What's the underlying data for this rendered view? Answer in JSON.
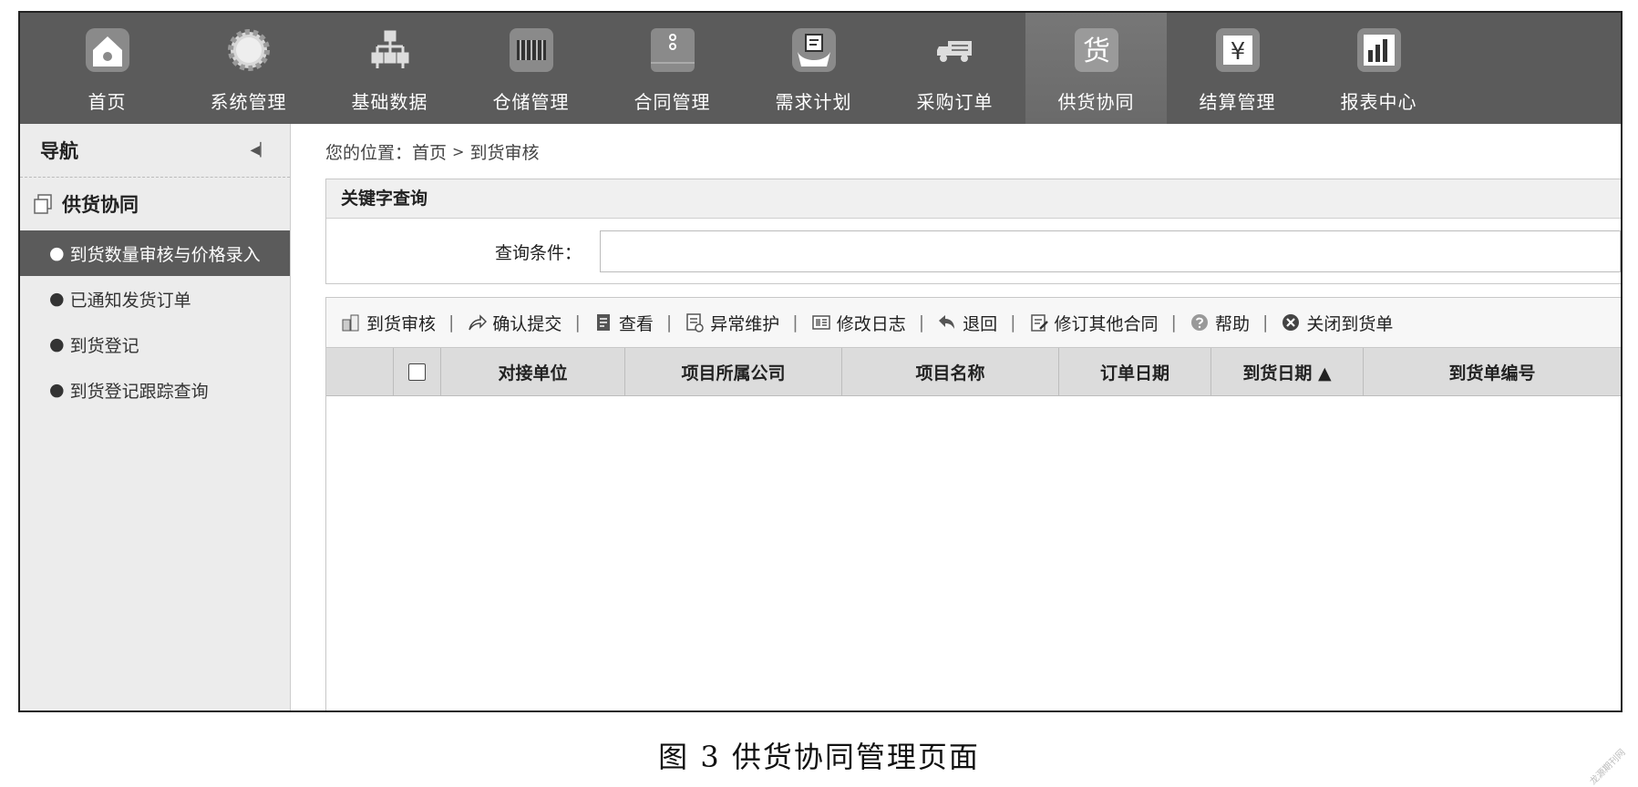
{
  "top_nav": {
    "items": [
      {
        "label": "首页",
        "icon": "home-icon"
      },
      {
        "label": "系统管理",
        "icon": "gear-icon"
      },
      {
        "label": "基础数据",
        "icon": "hierarchy-icon"
      },
      {
        "label": "仓储管理",
        "icon": "warehouse-icon"
      },
      {
        "label": "合同管理",
        "icon": "folder-icon"
      },
      {
        "label": "需求计划",
        "icon": "hand-document-icon"
      },
      {
        "label": "采购订单",
        "icon": "truck-icon"
      },
      {
        "label": "供货协同",
        "icon": "goods-icon",
        "icon_text": "货"
      },
      {
        "label": "结算管理",
        "icon": "yen-icon",
        "icon_text": "¥"
      },
      {
        "label": "报表中心",
        "icon": "bar-chart-icon"
      }
    ],
    "active_index": 7
  },
  "sidebar": {
    "title": "导航",
    "section": "供货协同",
    "items": [
      {
        "label": "到货数量审核与价格录入"
      },
      {
        "label": "已通知发货订单"
      },
      {
        "label": "到货登记"
      },
      {
        "label": "到货登记跟踪查询"
      }
    ],
    "active_index": 0,
    "bullet": "●"
  },
  "breadcrumb": {
    "prefix": "您的位置：",
    "home": "首页",
    "separator": ">",
    "current": "到货审核"
  },
  "query": {
    "title": "关键字查询",
    "label": "查询条件：",
    "value": ""
  },
  "toolbar": {
    "buttons": [
      {
        "label": "到货审核",
        "icon": "audit-icon"
      },
      {
        "label": "确认提交",
        "icon": "share-arrow-icon"
      },
      {
        "label": "查看",
        "icon": "view-icon"
      },
      {
        "label": "异常维护",
        "icon": "maintenance-icon"
      },
      {
        "label": "修改日志",
        "icon": "log-icon"
      },
      {
        "label": "退回",
        "icon": "return-icon"
      },
      {
        "label": "修订其他合同",
        "icon": "edit-contract-icon"
      },
      {
        "label": "帮助",
        "icon": "help-icon"
      },
      {
        "label": "关闭到货单",
        "icon": "close-circle-icon"
      }
    ],
    "separator": "|"
  },
  "grid": {
    "columns": [
      "对接单位",
      "项目所属公司",
      "项目名称",
      "订单日期",
      "到货日期 ▲",
      "到货单编号"
    ],
    "rows": []
  },
  "caption": "图 3   供货协同管理页面",
  "watermark": "龙源期刊网"
}
